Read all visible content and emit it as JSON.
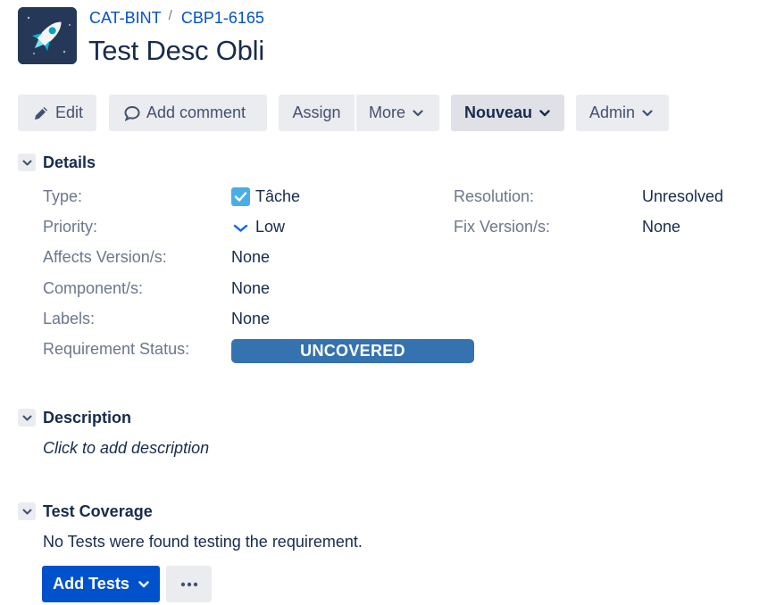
{
  "header": {
    "project_key": "CAT-BINT",
    "issue_key": "CBP1-6165",
    "separator": "/",
    "title": "Test Desc Obli",
    "project_icon": "rocket-icon"
  },
  "toolbar": {
    "edit_label": "Edit",
    "comment_label": "Add comment",
    "assign_label": "Assign",
    "more_label": "More",
    "status_label": "Nouveau",
    "admin_label": "Admin"
  },
  "details": {
    "section_title": "Details",
    "type_label": "Type:",
    "type_value": "Tâche",
    "priority_label": "Priority:",
    "priority_value": "Low",
    "affects_label": "Affects Version/s:",
    "affects_value": "None",
    "component_label": "Component/s:",
    "component_value": "None",
    "labels_label": "Labels:",
    "labels_value": "None",
    "req_status_label": "Requirement Status:",
    "req_status_value": "UNCOVERED",
    "resolution_label": "Resolution:",
    "resolution_value": "Unresolved",
    "fix_version_label": "Fix Version/s:",
    "fix_version_value": "None"
  },
  "description": {
    "section_title": "Description",
    "placeholder": "Click to add description"
  },
  "test_coverage": {
    "section_title": "Test Coverage",
    "message": "No Tests were found testing the requirement.",
    "add_tests_label": "Add Tests"
  },
  "colors": {
    "brand_blue": "#0052cc",
    "badge_blue": "#3572b0",
    "button_grey": "#ebecf0",
    "text_dark": "#172b4d",
    "text_muted": "#6b778c"
  }
}
